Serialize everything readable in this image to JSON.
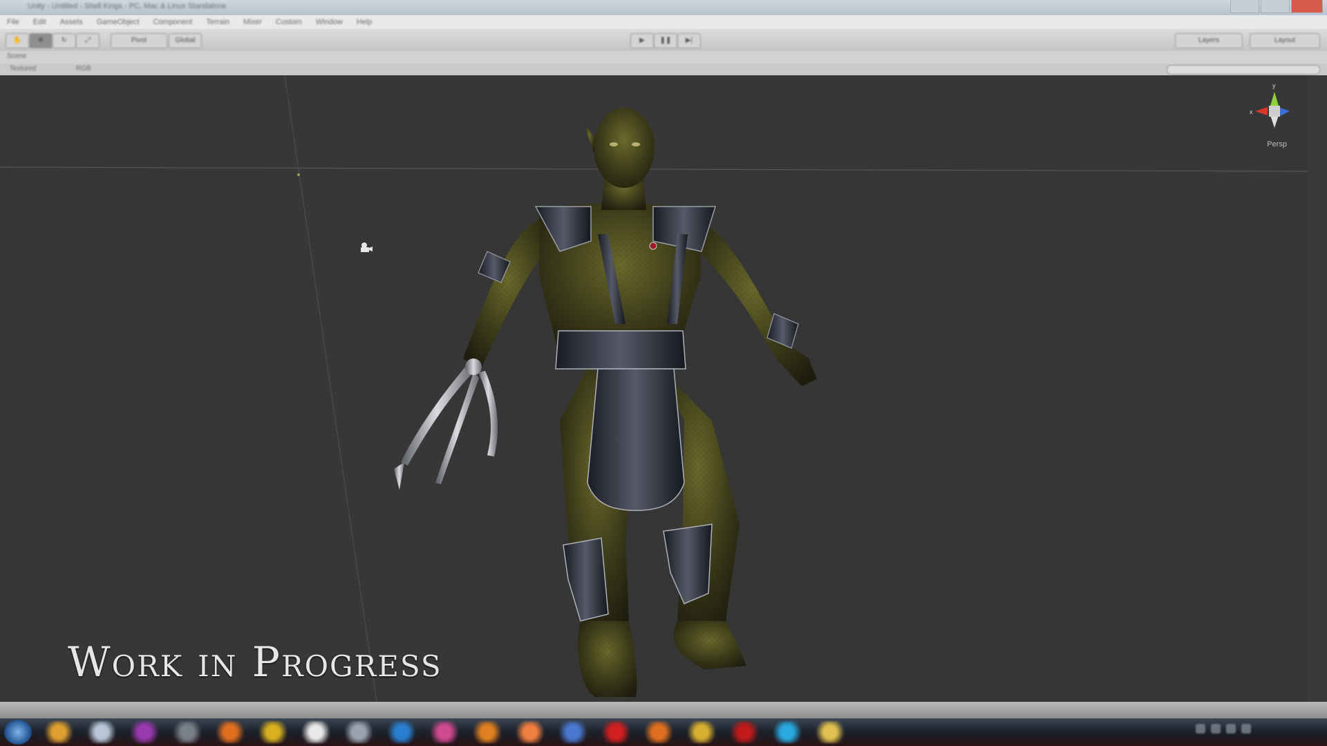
{
  "window": {
    "title": "Unity - Untitled - Shell Kings - PC, Mac & Linux Standalone"
  },
  "menu": [
    "File",
    "Edit",
    "Assets",
    "GameObject",
    "Component",
    "Terrain",
    "Mixer",
    "Custom",
    "Window",
    "Help"
  ],
  "toolbar": {
    "pivot_label": "Pivot",
    "global_label": "Global",
    "layers_label": "Layers",
    "layout_label": "Layout",
    "play_icon": "play-icon",
    "pause_icon": "pause-icon",
    "step_icon": "step-icon"
  },
  "scene": {
    "tab_label": "Scene",
    "shading_label": "Textured",
    "mode_label": "RGB",
    "view_label": "Persp",
    "axis_y": "y",
    "axis_x": "x"
  },
  "overlay": {
    "watermark": "Work in Progress"
  },
  "taskbar": {
    "apps": [
      {
        "name": "explorer",
        "color": "#e0a030"
      },
      {
        "name": "notepad",
        "color": "#b8c6d8"
      },
      {
        "name": "media",
        "color": "#9a3ab0"
      },
      {
        "name": "tool",
        "color": "#7a8088"
      },
      {
        "name": "firefox",
        "color": "#e07020"
      },
      {
        "name": "app-yellow",
        "color": "#d8b020"
      },
      {
        "name": "document",
        "color": "#e8e8e8"
      },
      {
        "name": "media-player",
        "color": "#9aa4b0"
      },
      {
        "name": "photoshop",
        "color": "#2a7fd0"
      },
      {
        "name": "app-pink",
        "color": "#d04a90"
      },
      {
        "name": "app-orange",
        "color": "#e08020"
      },
      {
        "name": "app-orange-2",
        "color": "#f08040"
      },
      {
        "name": "app-blue",
        "color": "#4a78d0"
      },
      {
        "name": "acrobat",
        "color": "#d02020"
      },
      {
        "name": "firefox-2",
        "color": "#e07020"
      },
      {
        "name": "app-gold",
        "color": "#d8b030"
      },
      {
        "name": "opera",
        "color": "#c01a1a"
      },
      {
        "name": "skype",
        "color": "#2aa8e0"
      },
      {
        "name": "folder",
        "color": "#e0c050"
      }
    ]
  }
}
